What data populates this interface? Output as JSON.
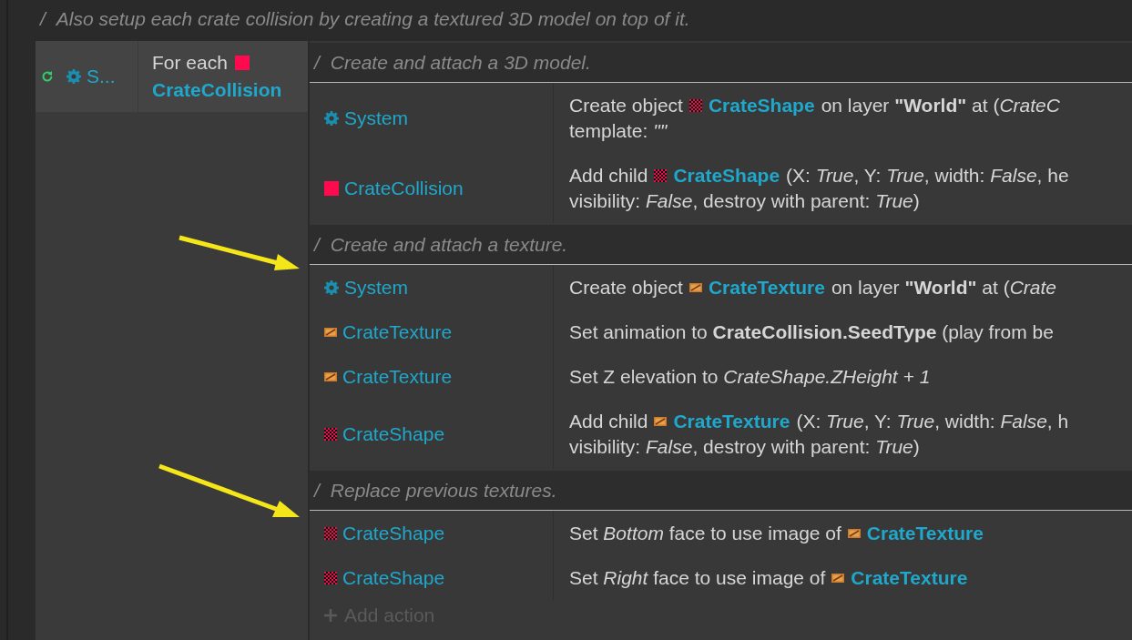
{
  "comment": {
    "marker": "/",
    "text": "Also setup each crate collision by creating a textured 3D model on top of it."
  },
  "event": {
    "condition": {
      "object": {
        "kind": "system",
        "name": "S..."
      },
      "text": "For each",
      "target": {
        "kind": "solid",
        "name": "CrateCollision"
      }
    },
    "actions": [
      {
        "kind": "comment",
        "marker": "/",
        "text": "Create and attach a 3D model."
      },
      {
        "kind": "action",
        "object": {
          "kind": "system",
          "name": "System"
        },
        "lines": [
          [
            {
              "kind": "text",
              "text": "Create object"
            },
            {
              "kind": "object",
              "object": {
                "kind": "checker",
                "name": "CrateShape"
              }
            },
            {
              "kind": "text",
              "text": "on layer **\"World\"** at (*CrateC*"
            }
          ],
          [
            {
              "kind": "text",
              "text": "template: *\"\"*"
            }
          ]
        ]
      },
      {
        "kind": "action",
        "object": {
          "kind": "solid",
          "name": "CrateCollision"
        },
        "lines": [
          [
            {
              "kind": "text",
              "text": "Add child"
            },
            {
              "kind": "object",
              "object": {
                "kind": "checker",
                "name": "CrateShape"
              }
            },
            {
              "kind": "text",
              "text": "(X: *True*, Y: *True*, width: *False*, he"
            }
          ],
          [
            {
              "kind": "text",
              "text": "visibility: *False*, destroy with parent: *True*)"
            }
          ]
        ]
      },
      {
        "kind": "comment",
        "marker": "/",
        "text": "Create and attach a texture."
      },
      {
        "kind": "action",
        "object": {
          "kind": "system",
          "name": "System"
        },
        "lines": [
          [
            {
              "kind": "text",
              "text": "Create object"
            },
            {
              "kind": "object",
              "object": {
                "kind": "texture",
                "name": "CrateTexture"
              }
            },
            {
              "kind": "text",
              "text": "on layer **\"World\"** at (*Crate*"
            }
          ]
        ]
      },
      {
        "kind": "action",
        "object": {
          "kind": "texture",
          "name": "CrateTexture"
        },
        "lines": [
          [
            {
              "kind": "text",
              "text": "Set animation to **CrateCollision.SeedType** (play from be"
            }
          ]
        ]
      },
      {
        "kind": "action",
        "object": {
          "kind": "texture",
          "name": "CrateTexture"
        },
        "lines": [
          [
            {
              "kind": "text",
              "text": "Set Z elevation to *CrateShape.ZHeight + 1*"
            }
          ]
        ]
      },
      {
        "kind": "action",
        "object": {
          "kind": "checker",
          "name": "CrateShape"
        },
        "lines": [
          [
            {
              "kind": "text",
              "text": "Add child"
            },
            {
              "kind": "object",
              "object": {
                "kind": "texture",
                "name": "CrateTexture"
              }
            },
            {
              "kind": "text",
              "text": "(X: *True*, Y: *True*, width: *False*, h"
            }
          ],
          [
            {
              "kind": "text",
              "text": "visibility: *False*, destroy with parent: *True*)"
            }
          ]
        ]
      },
      {
        "kind": "comment",
        "marker": "/",
        "text": "Replace previous textures."
      },
      {
        "kind": "action",
        "object": {
          "kind": "checker",
          "name": "CrateShape"
        },
        "lines": [
          [
            {
              "kind": "text",
              "text": "Set *Bottom* face to use image of"
            },
            {
              "kind": "object",
              "object": {
                "kind": "texture",
                "name": "CrateTexture"
              }
            }
          ]
        ]
      },
      {
        "kind": "action",
        "object": {
          "kind": "checker",
          "name": "CrateShape"
        },
        "lines": [
          [
            {
              "kind": "text",
              "text": "Set *Right* face to use image of"
            },
            {
              "kind": "object",
              "object": {
                "kind": "texture",
                "name": "CrateTexture"
              }
            }
          ]
        ]
      }
    ],
    "add_action": "Add action"
  }
}
